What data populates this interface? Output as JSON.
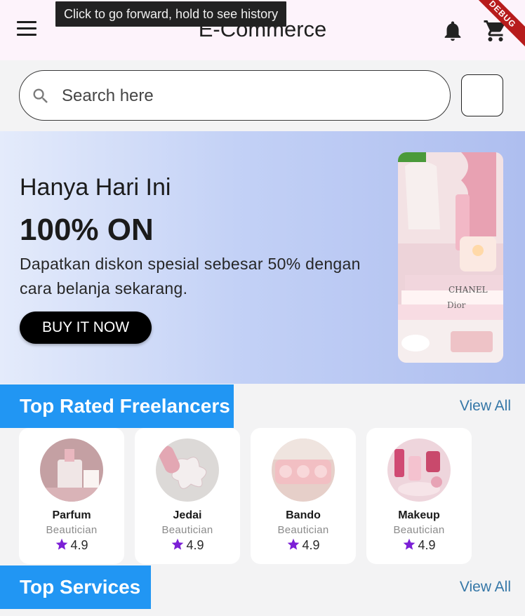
{
  "appbar": {
    "title": "E-Commerce",
    "tooltip": "Click to go forward, hold to see history",
    "debug_label": "DEBUG"
  },
  "search": {
    "placeholder": "Search here"
  },
  "banner": {
    "subtitle": "Hanya Hari Ini",
    "headline": "100% ON",
    "description": "Dapatkan diskon spesial sebesar 50% dengan cara belanja sekarang.",
    "button_label": "BUY IT NOW",
    "photo_text": [
      "CHANEL",
      "Dior"
    ]
  },
  "freelancers": {
    "title": "Top Rated Freelancers",
    "view_all": "View All",
    "items": [
      {
        "name": "Parfum",
        "role": "Beautician",
        "rating": "4.9"
      },
      {
        "name": "Jedai",
        "role": "Beautician",
        "rating": "4.9"
      },
      {
        "name": "Bando",
        "role": "Beautician",
        "rating": "4.9"
      },
      {
        "name": "Makeup",
        "role": "Beautician",
        "rating": "4.9"
      }
    ]
  },
  "services": {
    "title": "Top Services",
    "view_all": "View All"
  },
  "colors": {
    "accent_blue": "#2196f3",
    "link_blue": "#3577a7",
    "star_purple": "#7b1fd6",
    "appbar_bg": "#fdf3fb"
  }
}
